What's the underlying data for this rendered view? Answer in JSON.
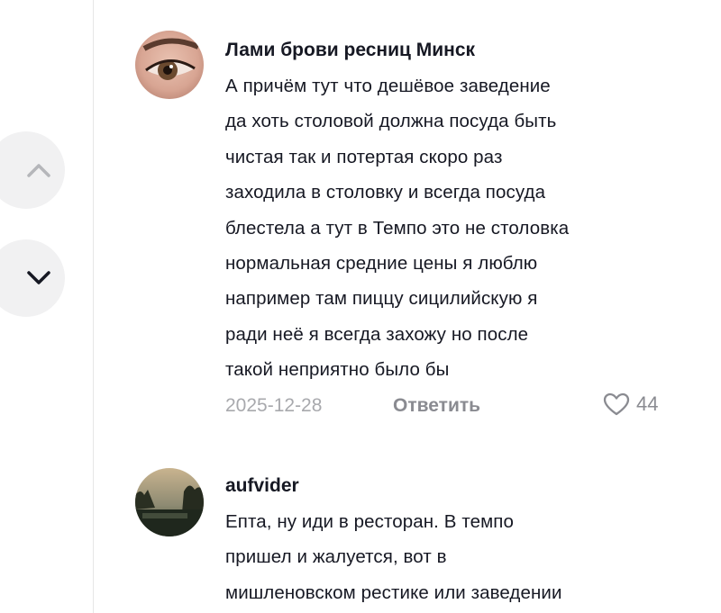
{
  "nav": {
    "up_icon": "chevron-up-icon",
    "down_icon": "chevron-down-icon"
  },
  "comments": [
    {
      "username": "Лами брови ресниц Минск",
      "avatar": "avatar-eye-closeup",
      "lines": [
        "А причём тут что дешёвое заведение",
        "да хоть столовой должна посуда быть",
        "чистая так и потертая скоро раз",
        "заходила в столовку и всегда посуда",
        "блестела а тут в Темпо это не столовка",
        "нормальная средние цены я люблю",
        "например там пиццу сицилийскую я",
        "ради неё я всегда захожу но после",
        "такой неприятно было бы"
      ],
      "date": "2025-12-28",
      "reply_label": "Ответить",
      "like_icon": "heart-icon",
      "likes": "44"
    },
    {
      "username": "aufvider",
      "avatar": "avatar-landscape-trees",
      "lines": [
        "Епта, ну иди в ресторан. В темпо",
        "пришел и жалуется, вот в",
        "мишленовском рестике или заведении"
      ]
    }
  ],
  "colors": {
    "text": "#161823",
    "muted": "#a8a9ad",
    "nav_bg": "#f1f1f2"
  }
}
